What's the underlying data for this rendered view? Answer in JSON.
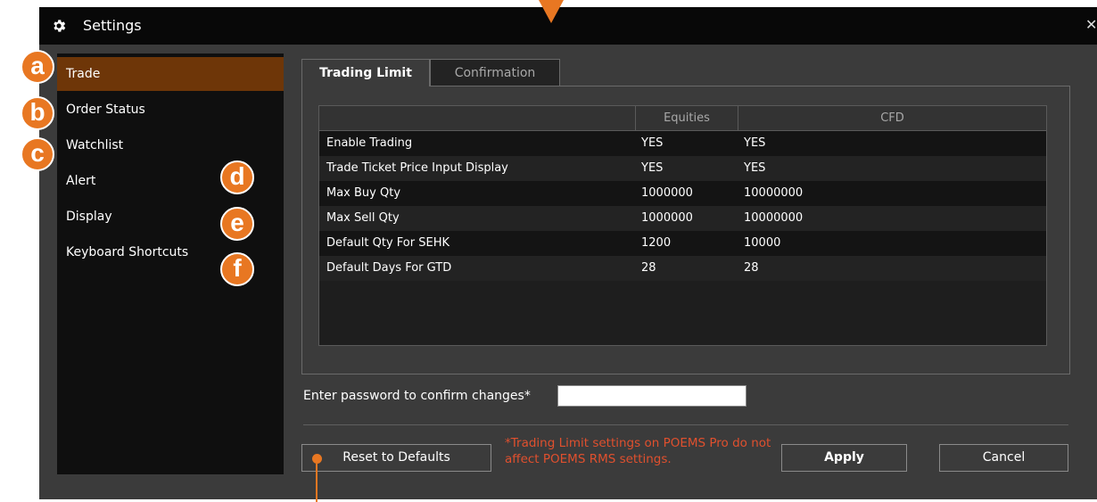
{
  "window": {
    "title": "Settings",
    "close_glyph": "✕"
  },
  "sidebar": {
    "items": [
      {
        "label": "Trade",
        "active": true
      },
      {
        "label": "Order Status",
        "active": false
      },
      {
        "label": "Watchlist",
        "active": false
      },
      {
        "label": "Alert",
        "active": false
      },
      {
        "label": "Display",
        "active": false
      },
      {
        "label": "Keyboard Shortcuts",
        "active": false
      }
    ]
  },
  "tabs": [
    {
      "label": "Trading Limit",
      "active": true
    },
    {
      "label": "Confirmation",
      "active": false
    }
  ],
  "table": {
    "columns": [
      "",
      "Equities",
      "CFD"
    ],
    "rows": [
      {
        "name": "Enable Trading",
        "equities": "YES",
        "cfd": "YES"
      },
      {
        "name": "Trade Ticket Price Input Display",
        "equities": "YES",
        "cfd": "YES"
      },
      {
        "name": "Max Buy Qty",
        "equities": "1000000",
        "cfd": "10000000"
      },
      {
        "name": "Max Sell Qty",
        "equities": "1000000",
        "cfd": "10000000"
      },
      {
        "name": "Default Qty For SEHK",
        "equities": "1200",
        "cfd": "10000"
      },
      {
        "name": "Default Days For GTD",
        "equities": "28",
        "cfd": "28"
      }
    ]
  },
  "password": {
    "label": "Enter password to confirm changes*",
    "value": ""
  },
  "buttons": {
    "reset": "Reset to Defaults",
    "apply": "Apply",
    "cancel": "Cancel"
  },
  "note": "*Trading Limit settings on POEMS Pro do not affect POEMS RMS settings.",
  "callouts": [
    "a",
    "b",
    "c",
    "d",
    "e",
    "f"
  ],
  "colors": {
    "accent": "#e87722",
    "active_item": "#6e3608",
    "warning_text": "#e0502e",
    "background": "#3b3b3b",
    "titlebar": "#080808"
  }
}
